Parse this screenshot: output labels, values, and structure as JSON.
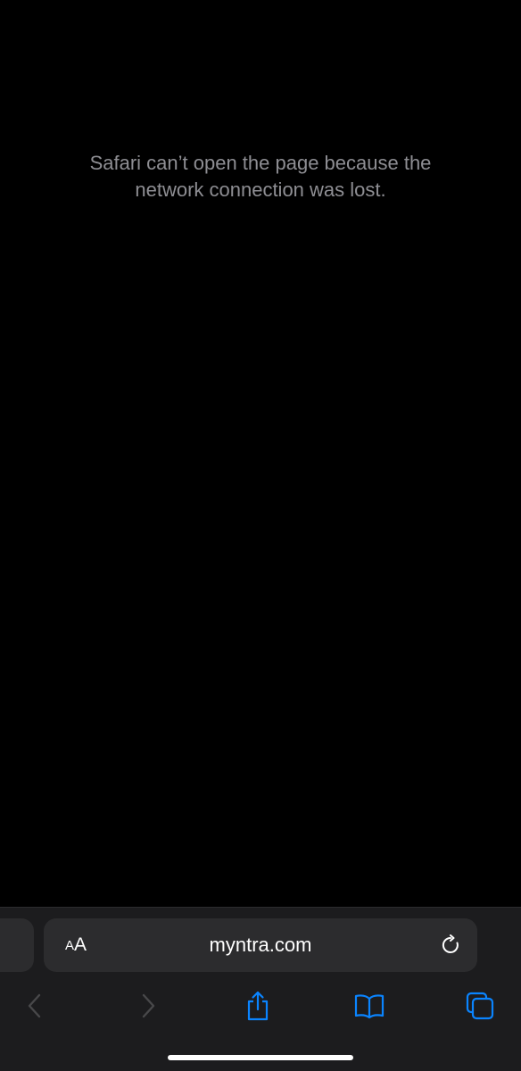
{
  "page": {
    "error_message": "Safari can’t open the page because the network connection was lost."
  },
  "address_bar": {
    "reader_small": "A",
    "reader_large": "A",
    "url": "myntra.com",
    "reload_icon": "reload-icon"
  },
  "toolbar": {
    "back_icon": "chevron-left-icon",
    "forward_icon": "chevron-right-icon",
    "share_icon": "share-icon",
    "bookmarks_icon": "book-icon",
    "tabs_icon": "tabs-icon"
  },
  "colors": {
    "background": "#000000",
    "toolbar": "#1c1c1e",
    "field": "#2c2c2e",
    "accent": "#0a84ff",
    "disabled": "#48484a",
    "secondary_text": "#8e8e93"
  }
}
